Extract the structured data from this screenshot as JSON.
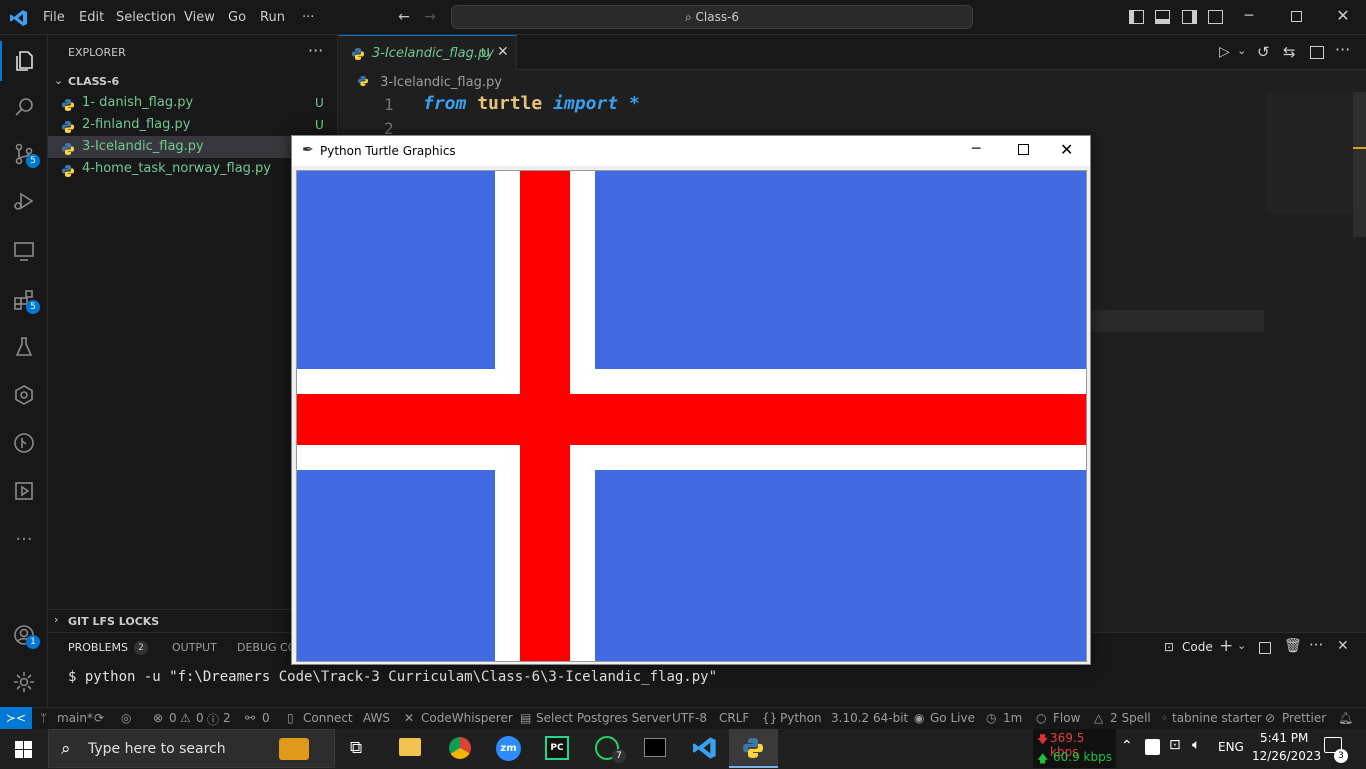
{
  "menu": {
    "file": "File",
    "edit": "Edit",
    "selection": "Selection",
    "view": "View",
    "go": "Go",
    "run": "Run",
    "more": "···"
  },
  "command_center": {
    "label": "Class-6"
  },
  "sidebar": {
    "title": "EXPLORER",
    "folder": "CLASS-6",
    "files": [
      {
        "name": "1- danish_flag.py",
        "status": "U"
      },
      {
        "name": "2-finland_flag.py",
        "status": "U"
      },
      {
        "name": "3-Icelandic_flag.py",
        "status": ""
      },
      {
        "name": "4-home_task_norway_flag.py",
        "status": ""
      }
    ],
    "git_lfs": "GIT LFS LOCKS",
    "badges": {
      "scm": "5",
      "extensions": "5",
      "accounts": "1"
    }
  },
  "editor": {
    "tab_label": "3-Icelandic_flag.py",
    "tab_status": "U",
    "breadcrumb": "3-Icelandic_flag.py",
    "line1_no": "1",
    "line2_no": "2",
    "code_from": "from",
    "code_module": "turtle",
    "code_import": "import",
    "code_star": "*"
  },
  "panel": {
    "problems": "PROBLEMS",
    "problems_count": "2",
    "output": "OUTPUT",
    "debug": "DEBUG CO",
    "terminal_name": "Code",
    "terminal_line": "$ python -u \"f:\\Dreamers Code\\Track-3 Curriculam\\Class-6\\3-Icelandic_flag.py\""
  },
  "turtle_window": {
    "title": "Python Turtle Graphics",
    "flag": {
      "field_color": "#4169e1",
      "cross_outer_color": "#ffffff",
      "cross_inner_color": "#ff0000"
    }
  },
  "status": {
    "branch": "main*",
    "errors": "0",
    "warnings": "0",
    "info": "2",
    "ports": "0",
    "connect": "Connect",
    "aws": "AWS",
    "codewhisperer": "CodeWhisperer",
    "postgres": "Select Postgres Server",
    "encoding": "UTF-8",
    "eol": "CRLF",
    "language": "Python",
    "version": "3.10.2 64-bit",
    "golive": "Go Live",
    "time": "1m",
    "flow": "Flow",
    "spell": "2 Spell",
    "tabnine": "tabnine starter",
    "prettier": "Prettier"
  },
  "taskbar": {
    "search_placeholder": "Type here to search",
    "net_down": "369.5 kbps",
    "net_up": "60.9 kbps",
    "lang": "ENG",
    "clock_time": "5:41 PM",
    "clock_date": "12/26/2023",
    "notif_count": "3",
    "whatsapp_count": "7"
  },
  "colors": {
    "accent": "#0078d4",
    "git_untracked": "#73c991"
  }
}
